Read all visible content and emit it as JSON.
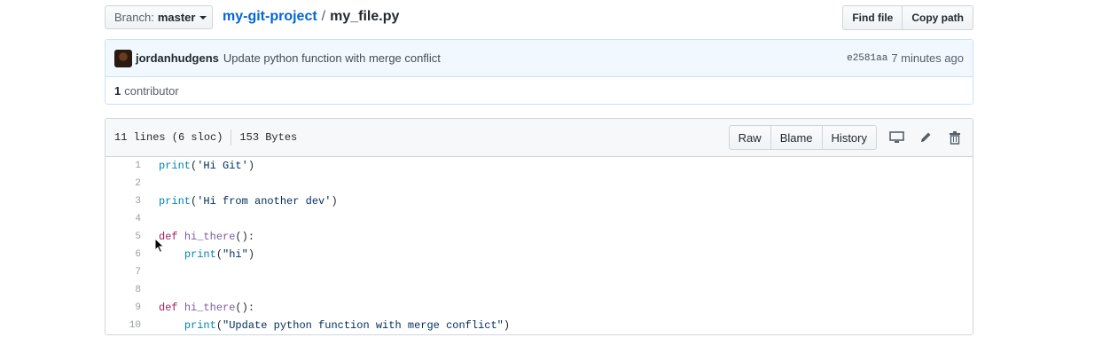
{
  "nav": {
    "branch_prefix": "Branch:",
    "branch_name": "master",
    "repo": "my-git-project",
    "separator": "/",
    "file": "my_file.py",
    "find_file": "Find file",
    "copy_path": "Copy path"
  },
  "commit": {
    "author": "jordanhudgens",
    "message": "Update python function with merge conflict",
    "sha": "e2581aa",
    "time": "7 minutes ago"
  },
  "contributors": {
    "count": "1",
    "label": "contributor"
  },
  "file_header": {
    "lines": "11 lines (6 sloc)",
    "size": "153 Bytes",
    "raw": "Raw",
    "blame": "Blame",
    "history": "History",
    "icons": [
      "desktop-icon",
      "pencil-icon",
      "trash-icon"
    ]
  },
  "code_lines": [
    {
      "n": "1",
      "tokens": [
        [
          "bi",
          "print"
        ],
        [
          "",
          "("
        ],
        [
          "str",
          "'Hi Git'"
        ],
        [
          "",
          ")"
        ]
      ]
    },
    {
      "n": "2",
      "tokens": []
    },
    {
      "n": "3",
      "tokens": [
        [
          "bi",
          "print"
        ],
        [
          "",
          "("
        ],
        [
          "str",
          "'Hi from another dev'"
        ],
        [
          "",
          ")"
        ]
      ]
    },
    {
      "n": "4",
      "tokens": []
    },
    {
      "n": "5",
      "tokens": [
        [
          "kw",
          "def"
        ],
        [
          "",
          " "
        ],
        [
          "fn",
          "hi_there"
        ],
        [
          "",
          "():"
        ]
      ]
    },
    {
      "n": "6",
      "tokens": [
        [
          "",
          "    "
        ],
        [
          "bi",
          "print"
        ],
        [
          "",
          "("
        ],
        [
          "str",
          "\"hi\""
        ],
        [
          "",
          ")"
        ]
      ]
    },
    {
      "n": "7",
      "tokens": []
    },
    {
      "n": "8",
      "tokens": []
    },
    {
      "n": "9",
      "tokens": [
        [
          "kw",
          "def"
        ],
        [
          "",
          " "
        ],
        [
          "fn",
          "hi_there"
        ],
        [
          "",
          "():"
        ]
      ]
    },
    {
      "n": "10",
      "tokens": [
        [
          "",
          "    "
        ],
        [
          "bi",
          "print"
        ],
        [
          "",
          "("
        ],
        [
          "str",
          "\"Update python function with merge conflict\""
        ],
        [
          "",
          ")"
        ]
      ]
    }
  ]
}
